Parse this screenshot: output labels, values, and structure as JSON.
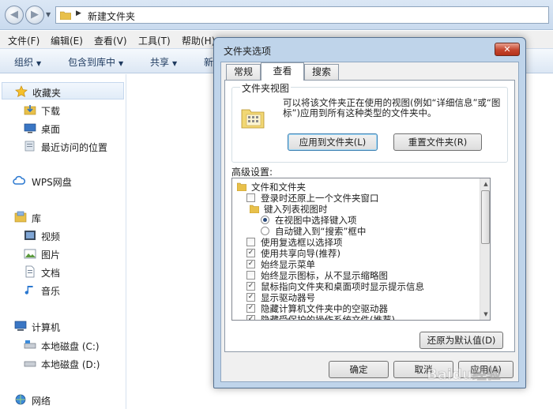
{
  "explorer": {
    "address": "新建文件夹",
    "menu": [
      "文件(F)",
      "编辑(E)",
      "查看(V)",
      "工具(T)",
      "帮助(H)"
    ],
    "toolbar": {
      "organize": "组织",
      "include_in_library": "包含到库中",
      "share": "共享",
      "new_partial": "新"
    },
    "nav": {
      "favorites": "收藏夹",
      "downloads": "下载",
      "desktop": "桌面",
      "recent_places": "最近访问的位置",
      "wps_drive": "WPS网盘",
      "libraries": "库",
      "videos": "视频",
      "pictures": "图片",
      "documents": "文档",
      "music": "音乐",
      "computer": "计算机",
      "local_disk_c": "本地磁盘 (C:)",
      "local_disk_d": "本地磁盘 (D:)",
      "network": "网络"
    }
  },
  "dialog": {
    "title": "文件夹选项",
    "tabs": [
      "常规",
      "查看",
      "搜索"
    ],
    "folder_views": {
      "legend": "文件夹视图",
      "description": "可以将该文件夹正在使用的视图(例如“详细信息”或“图标”)应用到所有这种类型的文件夹中。",
      "apply_button": "应用到文件夹(L)",
      "reset_button": "重置文件夹(R)"
    },
    "advanced_label": "高级设置:",
    "advanced_items": [
      {
        "text": "文件和文件夹",
        "kind": "folder",
        "checked": false
      },
      {
        "text": "登录时还原上一个文件夹窗口",
        "kind": "checkbox",
        "checked": false
      },
      {
        "text": "键入列表视图时",
        "kind": "folder",
        "checked": false
      },
      {
        "text": "在视图中选择键入项",
        "kind": "radio",
        "checked": true
      },
      {
        "text": "自动键入到“搜索”框中",
        "kind": "radio",
        "checked": false
      },
      {
        "text": "使用复选框以选择项",
        "kind": "checkbox",
        "checked": false
      },
      {
        "text": "使用共享向导(推荐)",
        "kind": "checkbox",
        "checked": true
      },
      {
        "text": "始终显示菜单",
        "kind": "checkbox",
        "checked": true
      },
      {
        "text": "始终显示图标，从不显示缩略图",
        "kind": "checkbox",
        "checked": false
      },
      {
        "text": "鼠标指向文件夹和桌面项时显示提示信息",
        "kind": "checkbox",
        "checked": true
      },
      {
        "text": "显示驱动器号",
        "kind": "checkbox",
        "checked": true
      },
      {
        "text": "隐藏计算机文件夹中的空驱动器",
        "kind": "checkbox",
        "checked": true
      },
      {
        "text": "隐藏受保护的操作系统文件(推荐)",
        "kind": "checkbox",
        "checked": true
      }
    ],
    "restore_defaults": "还原为默认值(D)",
    "ok": "确定",
    "cancel": "取消",
    "apply": "应用(A)"
  },
  "watermark": "Baidu经验",
  "colors": {
    "title_bar": "#bfd4ea",
    "close_button": "#c4452d",
    "toolbar_text": "#1e3a5f"
  }
}
